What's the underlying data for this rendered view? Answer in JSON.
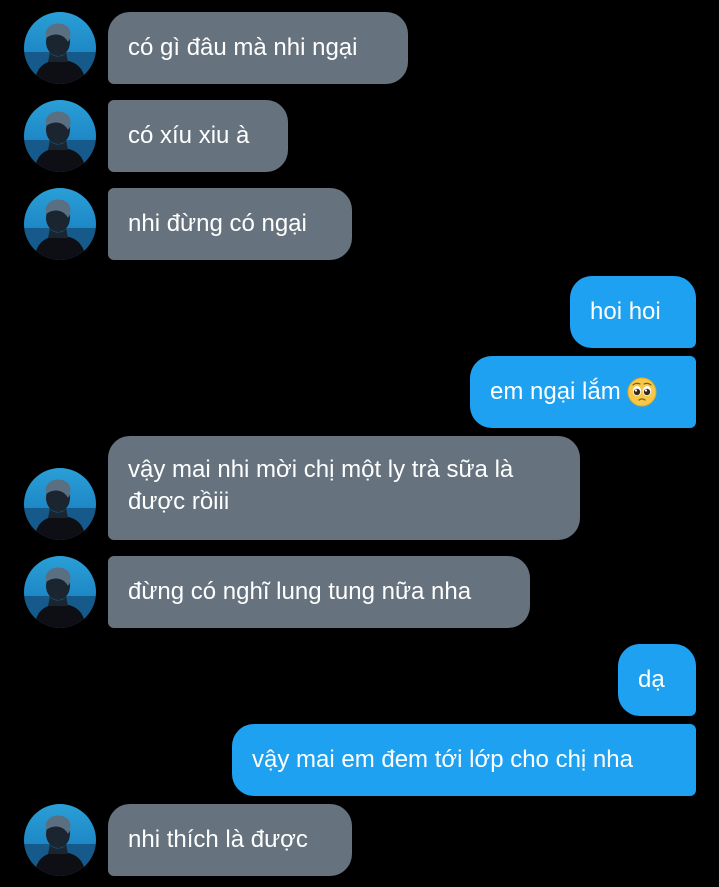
{
  "messages": [
    {
      "side": "in",
      "text": "có gì đâu mà nhi ngại"
    },
    {
      "side": "in",
      "text": "có xíu xiu à"
    },
    {
      "side": "in",
      "text": "nhi đừng có ngại"
    },
    {
      "side": "out",
      "text": "hoi hoi"
    },
    {
      "side": "out",
      "text": "em ngại lắm",
      "emoji": "pleading-face-icon"
    },
    {
      "side": "in",
      "text": "vậy mai nhi mời chị một ly trà sữa là được rồiii"
    },
    {
      "side": "in",
      "text": "đừng có nghĩ lung tung nữa nha"
    },
    {
      "side": "out",
      "text": "dạ"
    },
    {
      "side": "out",
      "text": "vậy mai em đem tới lớp cho chị nha"
    },
    {
      "side": "in",
      "text": "nhi thích là được"
    }
  ],
  "colors": {
    "background": "#000000",
    "incoming_bubble": "#66737f",
    "outgoing_bubble": "#1ea1f1",
    "text": "#ffffff"
  }
}
